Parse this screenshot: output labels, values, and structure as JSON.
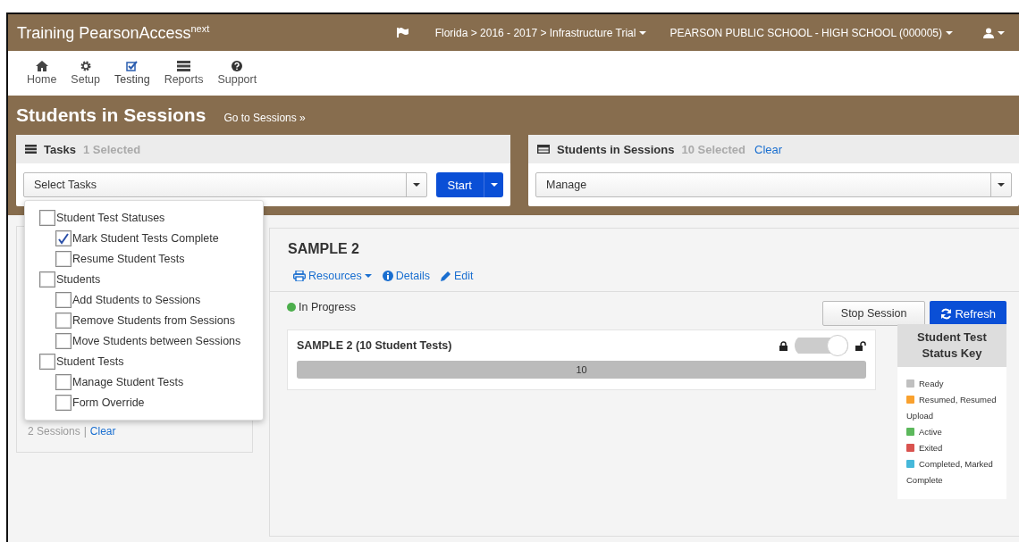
{
  "header": {
    "brand": "Training PearsonAccess",
    "brand_sup": "next",
    "breadcrumb": "Florida > 2016 - 2017 > Infrastructure Trial",
    "organization": "PEARSON PUBLIC SCHOOL - HIGH SCHOOL (000005)"
  },
  "nav": [
    {
      "label": "Home",
      "selected": false
    },
    {
      "label": "Setup",
      "selected": false
    },
    {
      "label": "Testing",
      "selected": true
    },
    {
      "label": "Reports",
      "selected": false
    },
    {
      "label": "Support",
      "selected": false
    }
  ],
  "page": {
    "title": "Students in Sessions",
    "link": "Go to Sessions »"
  },
  "tasks_panel": {
    "title": "Tasks",
    "count": "1 Selected",
    "select": "Select Tasks",
    "button": "Start",
    "menu": [
      {
        "label": "Student Test Statuses",
        "checked": false,
        "children": [
          {
            "label": "Mark Student Tests Complete",
            "checked": true
          },
          {
            "label": "Resume Student Tests",
            "checked": false
          }
        ]
      },
      {
        "label": "Students",
        "checked": false,
        "children": [
          {
            "label": "Add Students to Sessions",
            "checked": false
          },
          {
            "label": "Remove Students from Sessions",
            "checked": false
          },
          {
            "label": "Move Students between Sessions",
            "checked": false
          }
        ]
      },
      {
        "label": "Student Tests",
        "checked": false,
        "children": [
          {
            "label": "Manage Student Tests",
            "checked": false
          },
          {
            "label": "Form Override",
            "checked": false
          }
        ]
      }
    ]
  },
  "students_panel": {
    "title": "Students in Sessions",
    "count": "10 Selected",
    "clear": "Clear",
    "select": "Manage"
  },
  "sessions_sidebar": {
    "count": "2 Sessions",
    "separator": "|",
    "clear": "Clear"
  },
  "session": {
    "title": "SAMPLE 2",
    "actions": [
      "Resources",
      "Details",
      "Edit"
    ],
    "status": "In Progress",
    "buttons": [
      "Stop Session",
      "Refresh"
    ],
    "group": {
      "title": "SAMPLE 2 (10 Student Tests)",
      "unlocked": true,
      "bar": {
        "label": "10",
        "level": 1,
        "color": "#bbbbbb"
      }
    }
  },
  "status_key": {
    "title": "Student Test Status Key",
    "items": [
      {
        "label": "Ready",
        "color": "#c0c0c0"
      },
      {
        "label": "Resumed, Resumed Upload",
        "color": "#f9a12e"
      },
      {
        "label": "Active",
        "color": "#5cb85c"
      },
      {
        "label": "Exited",
        "color": "#d9534f"
      },
      {
        "label": "Completed, Marked Complete",
        "color": "#46b8da"
      }
    ]
  }
}
